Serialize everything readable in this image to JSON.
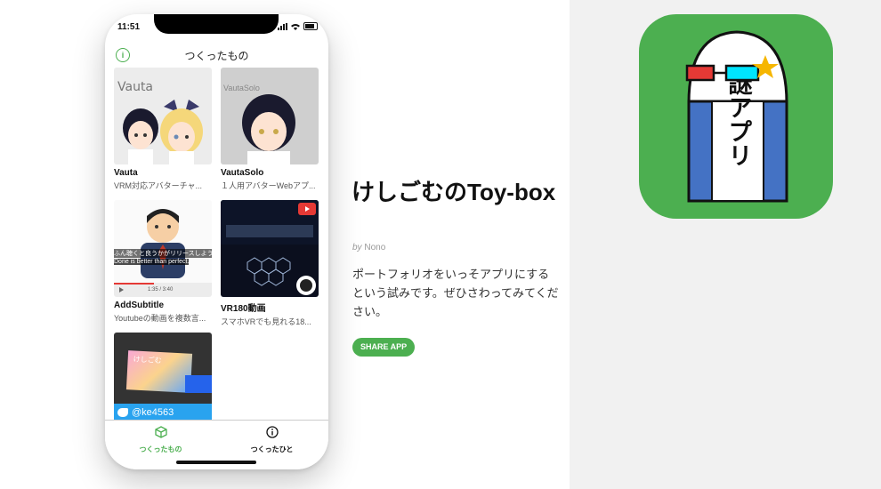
{
  "status": {
    "time": "11:51"
  },
  "header": {
    "title": "つくったもの"
  },
  "cards": [
    {
      "title": "Vauta",
      "desc": "VRM対応アバターチャ...",
      "overlay": "Vauta"
    },
    {
      "title": "VautaSolo",
      "desc": "１人用アバターWebアプ...",
      "overlay": "VautaSolo"
    },
    {
      "title": "AddSubtitle",
      "desc": "Youtubeの動画を複数言...",
      "subtitle_jp": "ふん聴くと良うかがリリースしよう",
      "subtitle_en": "Done is better than perfect.",
      "time": "1:35 / 3:40"
    },
    {
      "title": "VR180動画",
      "desc": "スマホVRでも見れる18..."
    },
    {
      "title": "",
      "desc": "",
      "handle": "@ke4563",
      "name_text": "けしごむ"
    }
  ],
  "tabs": [
    {
      "label": "つくったもの",
      "active": true
    },
    {
      "label": "つくったひと",
      "active": false
    }
  ],
  "app": {
    "name": "けしごむのToy-box",
    "by": "by",
    "author": "Nono",
    "description": "ポートフォリオをいっそアプリにするという試みです。ぜひさわってみてください。",
    "share_label": "SHARE APP",
    "icon_text": "謎アプリ"
  },
  "colors": {
    "accent": "#4caf50",
    "icon_bg": "#4caf50",
    "icon_blue": "#4472c4"
  }
}
